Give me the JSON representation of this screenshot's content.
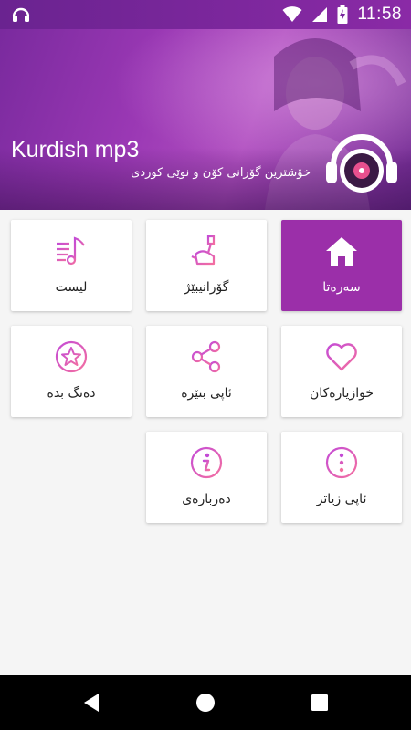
{
  "status_bar": {
    "time": "11:58",
    "icons": [
      "app-notification-icon",
      "wifi-icon",
      "signal-icon",
      "battery-charging-icon"
    ]
  },
  "header": {
    "title": "Kurdish mp3",
    "subtitle": "خۆشترین گۆرانی کۆن و نوێی کوردی",
    "logo_icon": "headphones-disc-icon"
  },
  "menu": {
    "tiles": [
      {
        "label": "سەرەتا",
        "icon": "home-icon",
        "active": true
      },
      {
        "label": "گۆرانیبێژ",
        "icon": "singer-microphone-icon",
        "active": false
      },
      {
        "label": "لیست",
        "icon": "playlist-music-icon",
        "active": false
      },
      {
        "label": "خوازیارەکان",
        "icon": "heart-icon",
        "active": false
      },
      {
        "label": "ئاپی بنێرە",
        "icon": "share-icon",
        "active": false
      },
      {
        "label": "دەنگ بدە",
        "icon": "star-circle-icon",
        "active": false
      },
      {
        "label": "ئاپی زیاتر",
        "icon": "more-dots-icon",
        "active": false
      },
      {
        "label": "دەربارەی",
        "icon": "info-icon",
        "active": false
      }
    ]
  },
  "nav_bar": {
    "icons": [
      "back-icon",
      "home-nav-icon",
      "recents-icon"
    ]
  },
  "colors": {
    "accent": "#9b2fa9",
    "icon_gradient_start": "#c44bd6",
    "icon_gradient_end": "#f46fa0"
  }
}
